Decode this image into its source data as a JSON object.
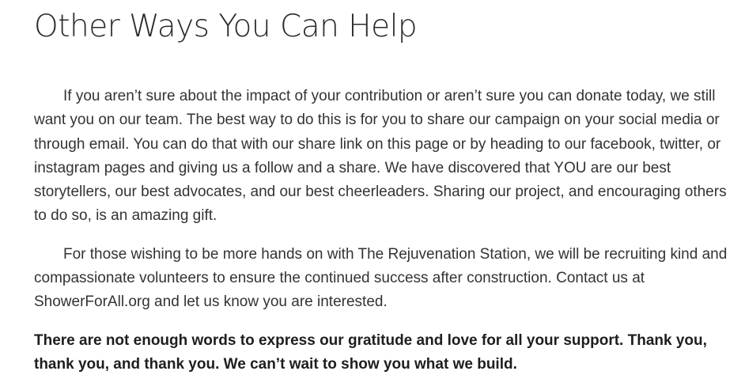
{
  "heading": "Other Ways You Can Help",
  "paragraphs": {
    "share": "If you aren’t sure about the impact of your contribution or aren’t sure you can donate today, we still want you on our team. The best way to do this is for you to share our campaign on your social media or through email. You can do that with our share link on this page or by heading to our facebook, twitter, or instagram pages and giving us a follow and a share. We have discovered that YOU are our best storytellers, our best advocates, and our best cheerleaders. Sharing our project, and encouraging others to do so, is an amazing gift.",
    "volunteer": "For those wishing to be more hands on with The Rejuvenation Station, we will be recruiting kind and compassionate volunteers to ensure the continued success after construction. Contact us at ShowerForAll.org and let us know you are interested.",
    "thanks": "There are not enough words to express our gratitude and love for all your support. Thank you, thank you, and thank you. We can’t wait to show you what we build."
  }
}
